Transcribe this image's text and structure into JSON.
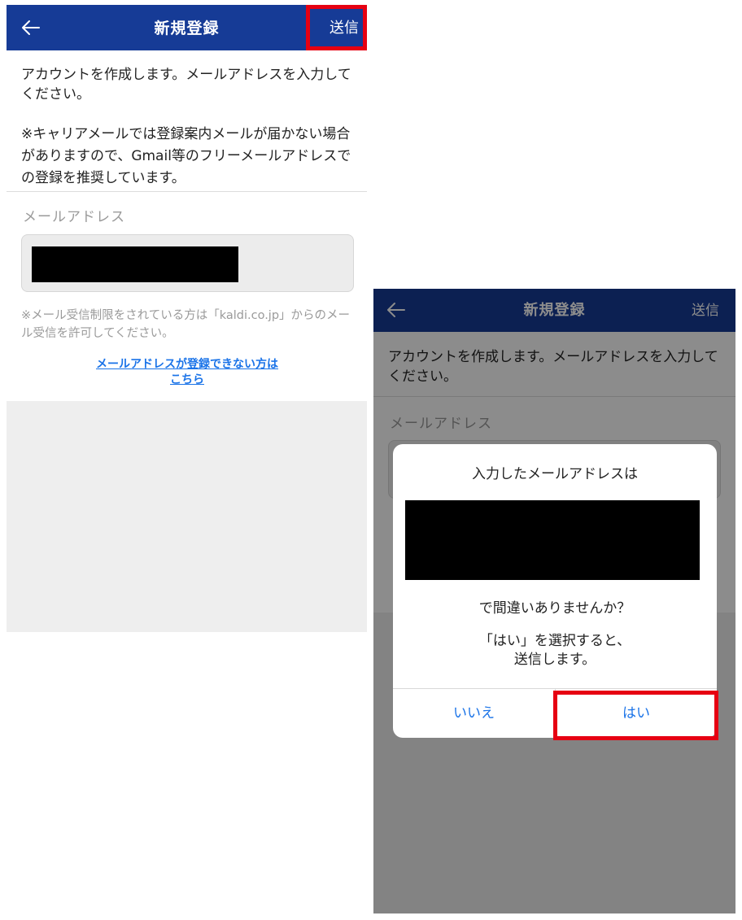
{
  "left_screen": {
    "nav": {
      "back_icon": "arrow-left-icon",
      "title": "新規登録",
      "send": "送信"
    },
    "intro": "アカウントを作成します。メールアドレスを入力してください。",
    "notice": "※キャリアメールでは登録案内メールが届かない場合がありますので、Gmail等のフリーメールアドレスでの登録を推奨しています。",
    "email_label": "メールアドレス",
    "hint": "※メール受信制限をされている方は「kaldi.co.jp」からのメール受信を許可してください。",
    "help_link_line1": "メールアドレスが登録できない方は",
    "help_link_line2": "こちら"
  },
  "right_screen": {
    "nav": {
      "back_icon": "arrow-left-icon",
      "title": "新規登録",
      "send": "送信"
    },
    "intro": "アカウントを作成します。メールアドレスを入力してください。",
    "email_label": "メールアドレス",
    "dialog": {
      "line1": "入力したメールアドレスは",
      "line2": "で間違いありませんか？",
      "line3": "「はい」を選択すると、\n送信します。",
      "no_button": "いいえ",
      "yes_button": "はい"
    }
  },
  "colors": {
    "navbar": "#163b96",
    "highlight": "#e60012",
    "link": "#1a73e8"
  }
}
